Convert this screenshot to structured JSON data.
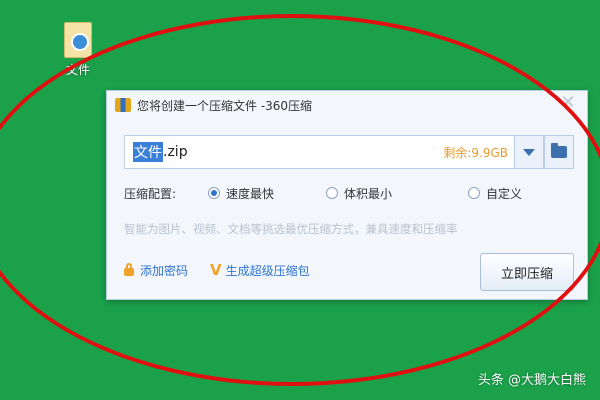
{
  "desktop": {
    "icon_label": "文件",
    "icon_name": "document-icon"
  },
  "dialog": {
    "title": "您将创建一个压缩文件 -360压缩",
    "close_glyph": "✕",
    "filename_selected": "文件",
    "filename_ext": ".zip",
    "remaining_space": "剩余:9.9GB",
    "options_label": "压缩配置:",
    "options": [
      {
        "label": "速度最快",
        "checked": true
      },
      {
        "label": "体积最小",
        "checked": false
      },
      {
        "label": "自定义",
        "checked": false
      }
    ],
    "hint": "智能为图片、视频、文档等挑选最优压缩方式，兼具速度和压缩率",
    "add_password": "添加密码",
    "create_sfx": "生成超级压缩包",
    "compress_now": "立即压缩"
  },
  "watermark": "头条 @大鹅大白熊",
  "colors": {
    "desktop_bg": "#1aa14a",
    "annotation": "#e01010",
    "accent": "#2f73d1",
    "highlight": "#e99a2d"
  }
}
